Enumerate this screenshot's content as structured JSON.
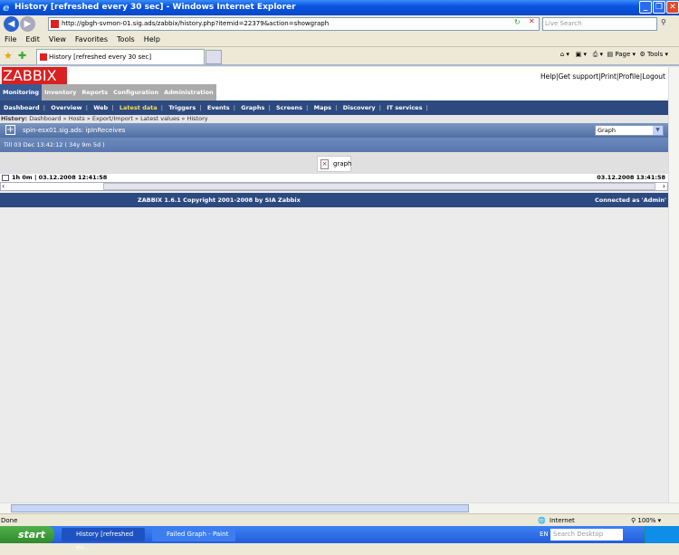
{
  "window": {
    "title": "History [refreshed every 30 sec] - Windows Internet Explorer"
  },
  "browser": {
    "url": "http://gbgh-svmon-01.sig.ads/zabbix/history.php?itemid=22379&action=showgraph",
    "search_placeholder": "Live Search",
    "menu": [
      "File",
      "Edit",
      "View",
      "Favorites",
      "Tools",
      "Help"
    ],
    "tab_title": "History [refreshed every 30 sec]",
    "toolbar": {
      "page": "Page",
      "tools": "Tools"
    },
    "status": "Done",
    "zone": "Internet",
    "zoom": "100%"
  },
  "zabbix": {
    "logo": "ZABBIX",
    "top_links": [
      "Help",
      "Get support",
      "Print",
      "Profile",
      "Logout"
    ],
    "main_tabs": [
      "Monitoring",
      "Inventory",
      "Reports",
      "Configuration",
      "Administration"
    ],
    "sub_tabs": [
      "Dashboard",
      "Overview",
      "Web",
      "Latest data",
      "Triggers",
      "Events",
      "Graphs",
      "Screens",
      "Maps",
      "Discovery",
      "IT services"
    ],
    "breadcrumb": {
      "label": "History:",
      "items": [
        "Dashboard",
        "Hosts",
        "Export/Import",
        "Latest values",
        "History"
      ]
    },
    "item_title": "spin-esx01.sig.ads: ipInReceives",
    "view_select": "Graph",
    "till": "Till 03 Dec 13:42:12 ( 34y 9m 5d )",
    "graph_alt": "graph",
    "period_left": "1h 0m | 03.12.2008 12:41:58",
    "period_right": "03.12.2008 13:41:58",
    "copyright": "ZABBIX 1.6.1 Copyright 2001-2008 by  SIA Zabbix",
    "connected": "Connected as 'Admin'"
  },
  "taskbar": {
    "start": "start",
    "tasks": [
      "History [refreshed ev...",
      "Failed Graph - Paint"
    ],
    "lang": "EN",
    "search_placeholder": "Search Desktop"
  }
}
